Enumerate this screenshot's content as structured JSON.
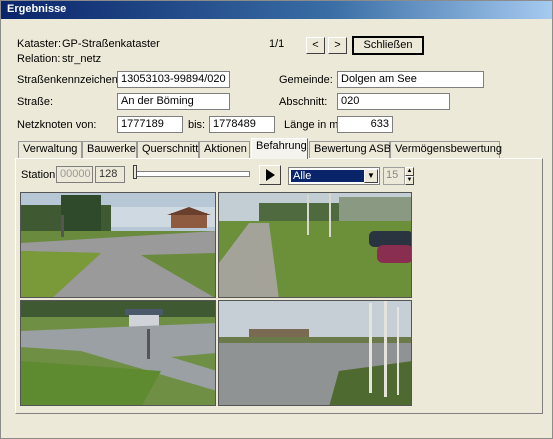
{
  "window": {
    "title": "Ergebnisse"
  },
  "header": {
    "kataster_label": "Kataster:",
    "kataster_value": "GP-Straßenkataster",
    "relation_label": "Relation:",
    "relation_value": "str_netz",
    "page_indicator": "1/1",
    "prev_label": "<",
    "next_label": ">",
    "close_label": "Schließen"
  },
  "form": {
    "strassenkennzeichen_label": "Straßenkennzeichen:",
    "strassenkennzeichen_value": "13053103-99894/020",
    "gemeinde_label": "Gemeinde:",
    "gemeinde_value": "Dolgen am See",
    "strasse_label": "Straße:",
    "strasse_value": "An der Böming",
    "abschnitt_label": "Abschnitt:",
    "abschnitt_value": "020",
    "netzknoten_label": "Netzknoten von:",
    "netzknoten_von": "1777189",
    "bis_label": "bis:",
    "netzknoten_bis": "1778489",
    "laenge_label": "Länge in m:",
    "laenge_value": "633"
  },
  "tabs": [
    {
      "label": "Verwaltung"
    },
    {
      "label": "Bauwerke"
    },
    {
      "label": "Querschnitt"
    },
    {
      "label": "Aktionen"
    },
    {
      "label": "Befahrung"
    },
    {
      "label": "Bewertung ASB"
    },
    {
      "label": "Vermögensbewertung"
    }
  ],
  "active_tab": "Befahrung",
  "befahrung": {
    "station_label": "Station",
    "station_from": "00000",
    "station_to": "128",
    "filter_value": "Alle",
    "interval_value": "15",
    "photos": [
      {
        "icon": "road-photo-intersection"
      },
      {
        "icon": "road-photo-parked-cars"
      },
      {
        "icon": "road-photo-shed"
      },
      {
        "icon": "road-photo-birch-trees"
      }
    ]
  }
}
